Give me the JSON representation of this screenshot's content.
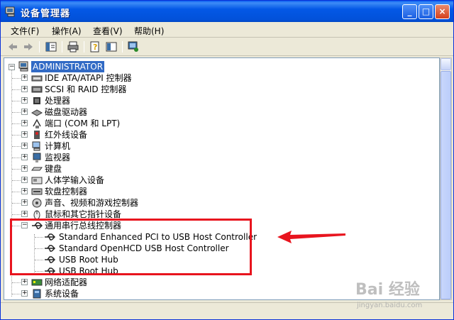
{
  "window": {
    "title": "设备管理器",
    "minimize": "_",
    "maximize": "□",
    "close": "×"
  },
  "menu": [
    "文件(F)",
    "操作(A)",
    "查看(V)",
    "帮助(H)"
  ],
  "toolbar_icons": [
    "back-icon",
    "forward-icon",
    "properties-icon",
    "print-icon",
    "help-icon",
    "view-icon",
    "scan-icon"
  ],
  "tree": {
    "root": "ADMINISTRATOR",
    "items": [
      "IDE ATA/ATAPI 控制器",
      "SCSI 和 RAID 控制器",
      "处理器",
      "磁盘驱动器",
      "端口 (COM 和 LPT)",
      "红外线设备",
      "计算机",
      "监视器",
      "键盘",
      "人体学输入设备",
      "软盘控制器",
      "声音、视频和游戏控制器",
      "鼠标和其它指针设备",
      "通用串行总线控制器"
    ],
    "usb_children": [
      "Standard Enhanced PCI to USB Host Controller",
      "Standard OpenHCD USB Host Controller",
      "USB Root Hub",
      "USB Root Hub"
    ],
    "after_items": [
      "网络适配器",
      "系统设备"
    ]
  },
  "watermark": {
    "text": "Bai 经验",
    "url": "jingyan.baidu.com"
  },
  "colors": {
    "highlight": "#e8141e",
    "selection": "#316ac5"
  }
}
